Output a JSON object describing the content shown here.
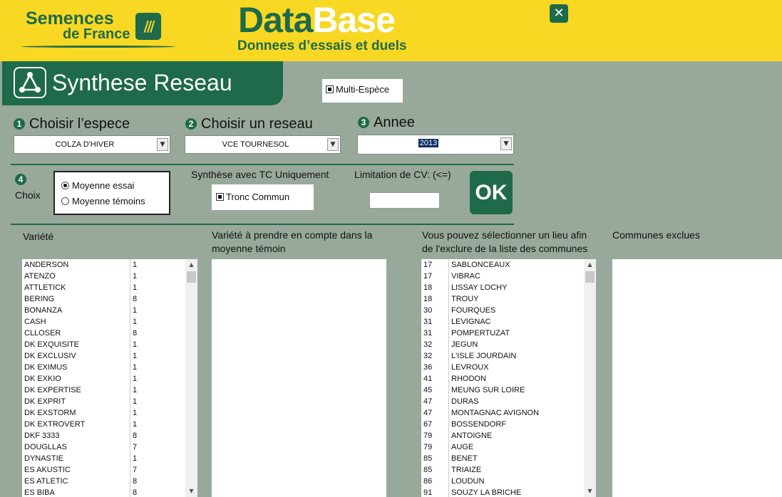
{
  "header": {
    "brand_line1": "Semences",
    "brand_line2": "de France",
    "brand_mark": "///",
    "app_title_part1": "Data",
    "app_title_part2": "Base",
    "app_subtitle": "Donnees d’essais et duels",
    "close_label": "✕"
  },
  "banner": {
    "title": "Synthese Reseau",
    "icon": "network-icon"
  },
  "multi_espece": {
    "label": "Multi-Espèce",
    "checked": true
  },
  "steps": {
    "espece": {
      "num": "1",
      "label": "Choisir l’espece",
      "value": "COLZA D'HIVER"
    },
    "reseau": {
      "num": "2",
      "label": "Choisir un reseau",
      "value": "VCE TOURNESOL"
    },
    "annee": {
      "num": "3",
      "label": "Annee",
      "value": "2013"
    },
    "choix": {
      "num": "4",
      "label": "Choix"
    }
  },
  "choix_options": [
    {
      "label": "Moyenne essai",
      "selected": true
    },
    {
      "label": "Moyenne témoins",
      "selected": false
    }
  ],
  "tc": {
    "heading": "Synthèse avec TC Uniquement",
    "checkbox_label": "Tronc Commun",
    "checked": true
  },
  "cv": {
    "label": "Limitation de CV: (<=)",
    "value": ""
  },
  "ok_label": "OK",
  "columns": {
    "variete": "Variété",
    "temoin_line1": "Variété à prendre en compte dans la",
    "temoin_line2": "moyenne témoin",
    "lieu_line1": "Vous pouvez sélectionner un lieu afin",
    "lieu_line2": "de l'exclure de la liste des communes",
    "exclues": "Communes exclues"
  },
  "varietes": [
    [
      "ANDERSON",
      "1"
    ],
    [
      "ATENZO",
      "1"
    ],
    [
      "ATTLETICK",
      "1"
    ],
    [
      "BERING",
      "8"
    ],
    [
      "BONANZA",
      "1"
    ],
    [
      "CASH",
      "1"
    ],
    [
      "CLLOSER",
      "8"
    ],
    [
      "DK EXQUISITE",
      "1"
    ],
    [
      "DK EXCLUSIV",
      "1"
    ],
    [
      "DK EXIMUS",
      "1"
    ],
    [
      "DK EXKIO",
      "1"
    ],
    [
      "DK EXPERTISE",
      "1"
    ],
    [
      "DK EXPRIT",
      "1"
    ],
    [
      "DK EXSTORM",
      "1"
    ],
    [
      "DK EXTROVERT",
      "1"
    ],
    [
      "DKF 3333",
      "8"
    ],
    [
      "DOUGLLAS",
      "7"
    ],
    [
      "DYNASTIE",
      "1"
    ],
    [
      "ES AKUSTIC",
      "7"
    ],
    [
      "ES ATLETIC",
      "8"
    ],
    [
      "ES BIBA",
      "8"
    ]
  ],
  "lieux": [
    [
      "17",
      "SABLONCEAUX"
    ],
    [
      "17",
      "VIBRAC"
    ],
    [
      "18",
      "LISSAY LOCHY"
    ],
    [
      "18",
      "TROUY"
    ],
    [
      "30",
      "FOURQUES"
    ],
    [
      "31",
      "LEVIGNAC"
    ],
    [
      "31",
      "POMPERTUZAT"
    ],
    [
      "32",
      "JEGUN"
    ],
    [
      "32",
      "L'ISLE JOURDAIN"
    ],
    [
      "36",
      "LEVROUX"
    ],
    [
      "41",
      "RHODON"
    ],
    [
      "45",
      "MEUNG SUR LOIRE"
    ],
    [
      "47",
      "DURAS"
    ],
    [
      "47",
      "MONTAGNAC AVIGNON"
    ],
    [
      "67",
      "BOSSENDORF"
    ],
    [
      "79",
      "ANTOIGNE"
    ],
    [
      "79",
      "AUGE"
    ],
    [
      "85",
      "BENET"
    ],
    [
      "85",
      "TRIAIZE"
    ],
    [
      "86",
      "LOUDUN"
    ],
    [
      "91",
      "SOUZY LA BRICHE"
    ]
  ],
  "scroll": {
    "up_glyph": "▲",
    "down_glyph": "▼",
    "dropdown_glyph": "▼"
  }
}
